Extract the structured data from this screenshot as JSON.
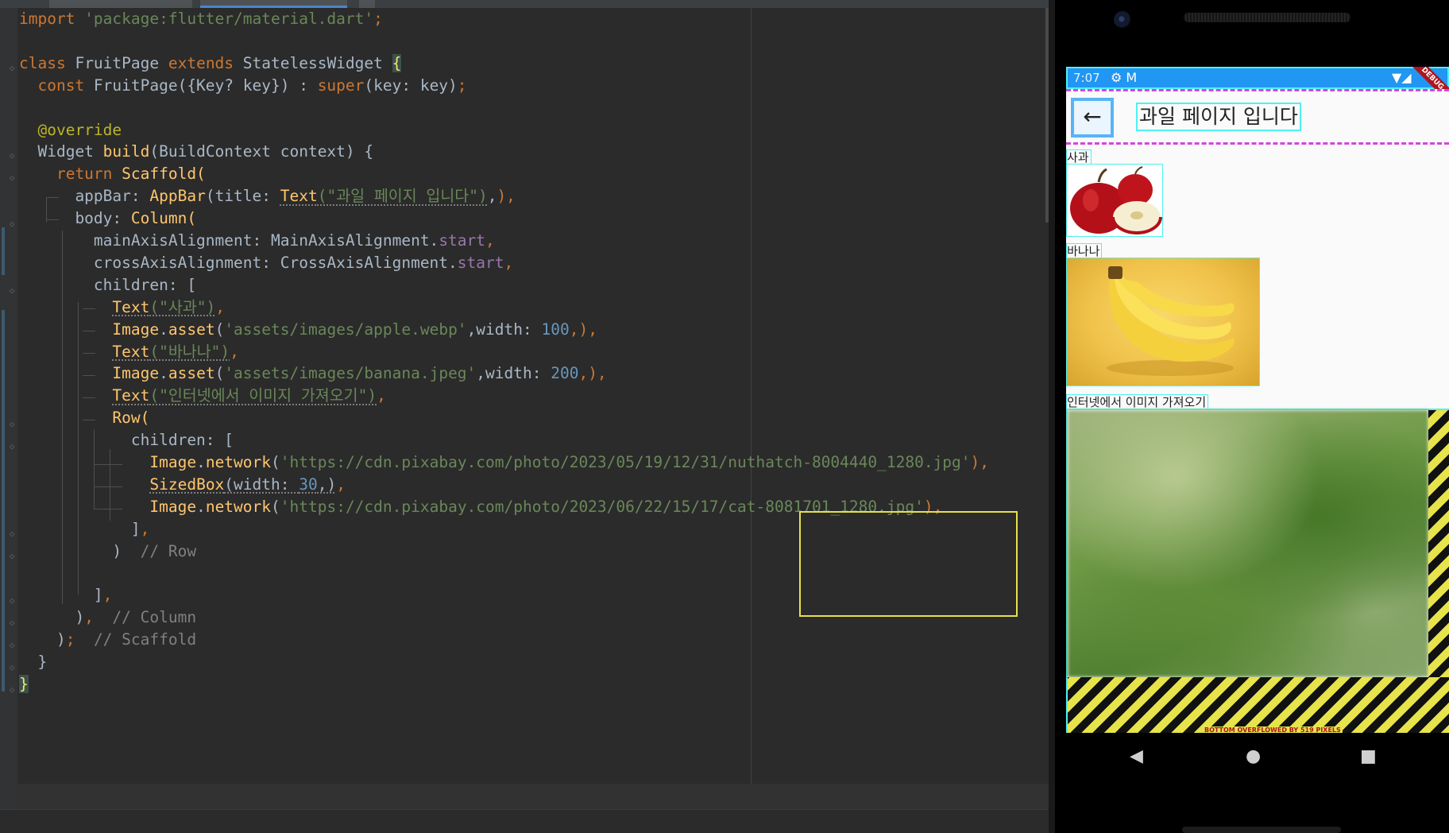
{
  "editor": {
    "lines": [
      [
        {
          "t": "import ",
          "c": "kw"
        },
        {
          "t": "'package:flutter/material.dart'",
          "c": "str"
        },
        {
          "t": ";",
          "c": "kw"
        }
      ],
      [],
      [
        {
          "t": "class ",
          "c": "kw"
        },
        {
          "t": "FruitPage "
        },
        {
          "t": "extends ",
          "c": "kw"
        },
        {
          "t": "StatelessWidget "
        },
        {
          "t": "{",
          "c": "brace"
        }
      ],
      [
        {
          "t": "  const ",
          "c": "kw"
        },
        {
          "t": "FruitPage({Key? key}) : "
        },
        {
          "t": "super",
          "c": "kw"
        },
        {
          "t": "(key: key)"
        },
        {
          "t": ";",
          "c": "kw"
        }
      ],
      [],
      [
        {
          "t": "  @override",
          "c": "ann"
        }
      ],
      [
        {
          "t": "  Widget "
        },
        {
          "t": "build",
          "c": "fn"
        },
        {
          "t": "(BuildContext context) {"
        }
      ],
      [
        {
          "t": "    return ",
          "c": "kw"
        },
        {
          "t": "Scaffold(",
          "c": "fn"
        }
      ],
      [
        {
          "t": "      appBar: "
        },
        {
          "t": "AppBar",
          "c": "fn"
        },
        {
          "t": "(title: "
        },
        {
          "t": "Text",
          "c": "fn squiggle"
        },
        {
          "t": "(\"과일 페이지 입니다\")",
          "c": "str squiggle"
        },
        {
          "t": ","
        },
        {
          "t": "),",
          "c": "kw"
        }
      ],
      [
        {
          "t": "      body: "
        },
        {
          "t": "Column(",
          "c": "fn"
        }
      ],
      [
        {
          "t": "        mainAxisAlignment: MainAxisAlignment."
        },
        {
          "t": "start",
          "c": "prop"
        },
        {
          "t": ",",
          "c": "kw"
        }
      ],
      [
        {
          "t": "        crossAxisAlignment: CrossAxisAlignment."
        },
        {
          "t": "start",
          "c": "prop"
        },
        {
          "t": ",",
          "c": "kw"
        }
      ],
      [
        {
          "t": "        children: ["
        }
      ],
      [
        {
          "t": "          "
        },
        {
          "t": "Text",
          "c": "fn squiggle"
        },
        {
          "t": "(\"사과\")",
          "c": "str squiggle"
        },
        {
          "t": ",",
          "c": "kw"
        }
      ],
      [
        {
          "t": "          "
        },
        {
          "t": "Image",
          "c": "fn"
        },
        {
          "t": "."
        },
        {
          "t": "asset",
          "c": "fn"
        },
        {
          "t": "("
        },
        {
          "t": "'assets/images/apple.webp'",
          "c": "str"
        },
        {
          "t": ",width: "
        },
        {
          "t": "100",
          "c": "num"
        },
        {
          "t": ",),",
          "c": "kw"
        }
      ],
      [
        {
          "t": "          "
        },
        {
          "t": "Text",
          "c": "fn squiggle"
        },
        {
          "t": "(\"바나나\")",
          "c": "str squiggle"
        },
        {
          "t": ",",
          "c": "kw"
        }
      ],
      [
        {
          "t": "          "
        },
        {
          "t": "Image",
          "c": "fn"
        },
        {
          "t": "."
        },
        {
          "t": "asset",
          "c": "fn"
        },
        {
          "t": "("
        },
        {
          "t": "'assets/images/banana.jpeg'",
          "c": "str"
        },
        {
          "t": ",width: "
        },
        {
          "t": "200",
          "c": "num"
        },
        {
          "t": ",),",
          "c": "kw"
        }
      ],
      [
        {
          "t": "          "
        },
        {
          "t": "Text",
          "c": "fn squiggle"
        },
        {
          "t": "(\"인터넷에서 이미지 가져오기\")",
          "c": "str squiggle"
        },
        {
          "t": ",",
          "c": "kw"
        }
      ],
      [
        {
          "t": "          "
        },
        {
          "t": "Row(",
          "c": "fn"
        }
      ],
      [
        {
          "t": "            children: ["
        }
      ],
      [
        {
          "t": "              "
        },
        {
          "t": "Image",
          "c": "fn"
        },
        {
          "t": "."
        },
        {
          "t": "network",
          "c": "fn"
        },
        {
          "t": "("
        },
        {
          "t": "'https://cdn.pixabay.com/photo/2023/05/19/12/31/nuthatch-8004440_1280.jpg'",
          "c": "str"
        },
        {
          "t": "),",
          "c": "kw"
        }
      ],
      [
        {
          "t": "              "
        },
        {
          "t": "SizedBox",
          "c": "fn squiggle"
        },
        {
          "t": "(width: ",
          "c": "squiggle"
        },
        {
          "t": "30",
          "c": "num squiggle"
        },
        {
          "t": ",)",
          "c": "squiggle"
        },
        {
          "t": ",",
          "c": "kw"
        }
      ],
      [
        {
          "t": "              "
        },
        {
          "t": "Image",
          "c": "fn"
        },
        {
          "t": "."
        },
        {
          "t": "network",
          "c": "fn"
        },
        {
          "t": "("
        },
        {
          "t": "'https://cdn.pixabay.com/photo/2023/06/22/15/17/cat-8081701_1280.jpg'",
          "c": "str"
        },
        {
          "t": "),",
          "c": "kw"
        }
      ],
      [
        {
          "t": "            ]"
        },
        {
          "t": ",",
          "c": "kw"
        }
      ],
      [
        {
          "t": "          )  "
        },
        {
          "t": "// Row",
          "c": "cmt"
        }
      ],
      [],
      [
        {
          "t": "        ]"
        },
        {
          "t": ",",
          "c": "kw"
        }
      ],
      [
        {
          "t": "      )"
        },
        {
          "t": ",  ",
          "c": "kw"
        },
        {
          "t": "// Column",
          "c": "cmt"
        }
      ],
      [
        {
          "t": "    )"
        },
        {
          "t": ";  ",
          "c": "kw"
        },
        {
          "t": "// Scaffold",
          "c": "cmt"
        }
      ],
      [
        {
          "t": "  }"
        }
      ],
      [
        {
          "t": "}",
          "c": "brace"
        }
      ]
    ]
  },
  "device": {
    "status_time": "7:07",
    "status_left_icons": "⚙ M",
    "status_right_icons": "▼◢",
    "debug_banner": "DEBUG",
    "appbar_title": "과일 페이지 입니다",
    "back_icon": "arrow-left-icon",
    "apple_label": "사과",
    "banana_label": "바나나",
    "internet_label": "인터넷에서 이미지 가져오기",
    "overflow_message": "BOTTOM OVERFLOWED BY 519 PIXELS",
    "nav_back": "◀",
    "nav_home": "●",
    "nav_recent": "■"
  },
  "colors": {
    "status_bar": "#2196f3",
    "overflow_stripe": "#e7e34b",
    "highlight_box": "#e6e04c"
  }
}
